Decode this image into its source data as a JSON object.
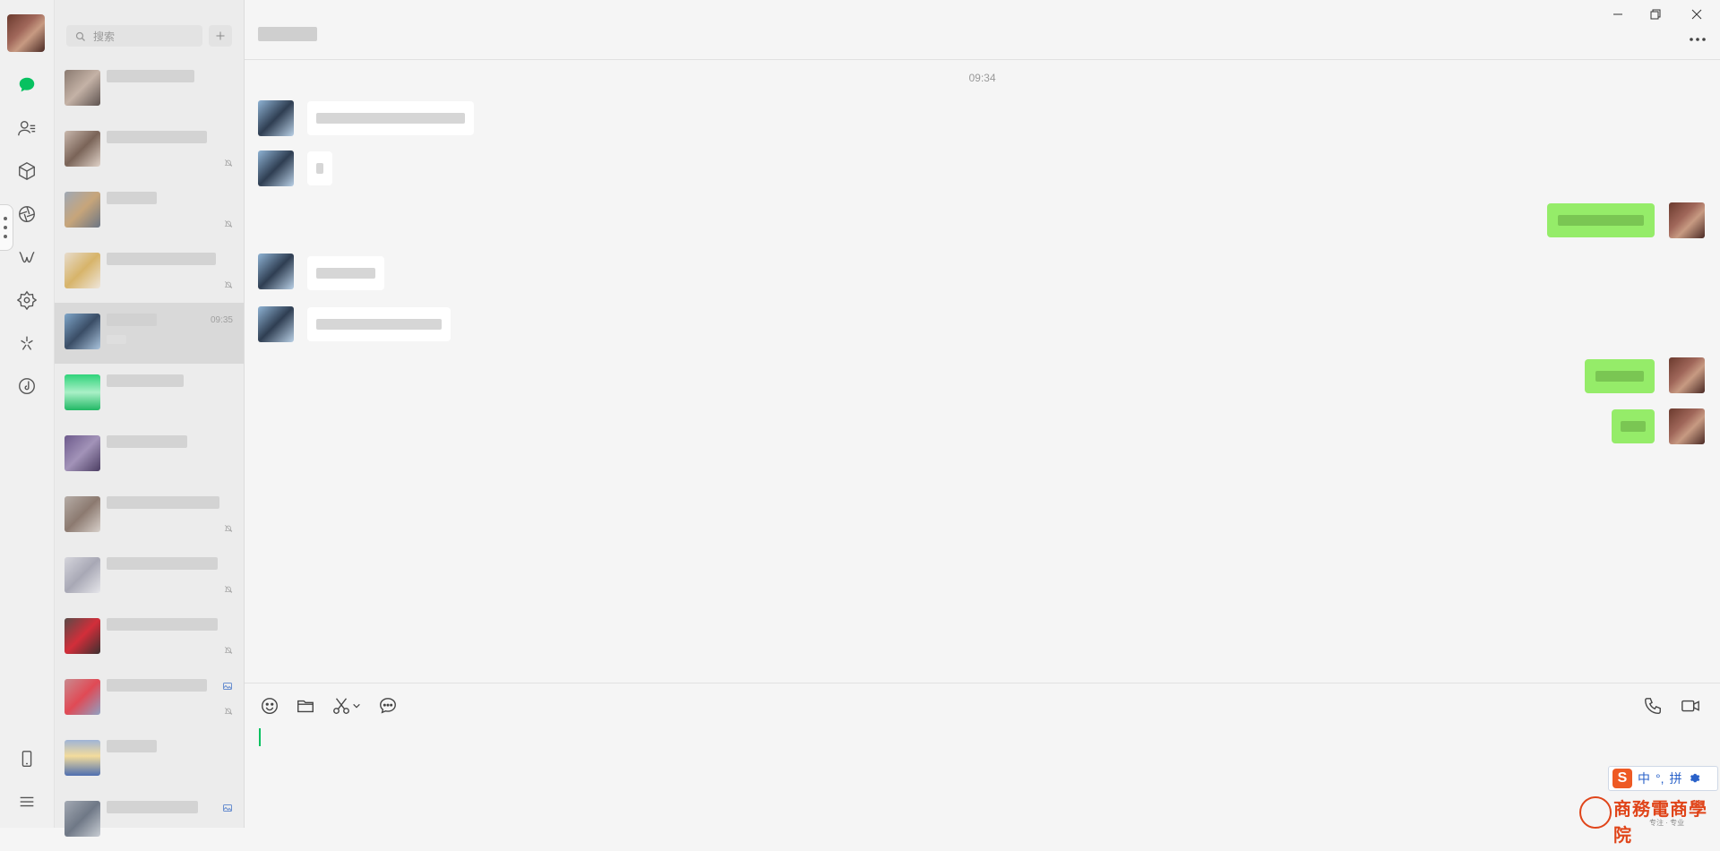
{
  "search": {
    "placeholder": "搜索"
  },
  "chat": {
    "timestamp": "09:34"
  },
  "conversations": [
    {
      "time": ""
    },
    {
      "time": ""
    },
    {
      "time": ""
    },
    {
      "time": ""
    },
    {
      "time": "09:35"
    },
    {
      "time": ""
    },
    {
      "time": ""
    },
    {
      "time": ""
    },
    {
      "time": ""
    },
    {
      "time": ""
    },
    {
      "time": ""
    },
    {
      "time": ""
    },
    {
      "time": ""
    }
  ],
  "ime": {
    "zh": "中",
    "punct": "°,",
    "pinyin": "拼"
  },
  "watermark": {
    "title": "商務電商學院",
    "subtitle": "专注 · 专业"
  },
  "colors": {
    "accent": "#07c160",
    "outgoing_bubble": "#95ec69",
    "incoming_bubble": "#ffffff"
  }
}
